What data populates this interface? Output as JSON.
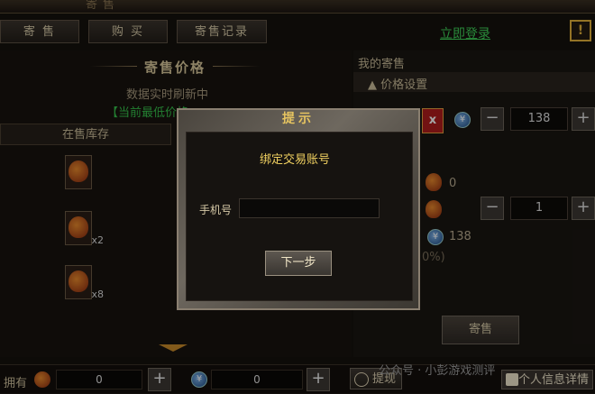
{
  "header": {
    "title": "寄售"
  },
  "tabs": [
    {
      "label": "寄 售"
    },
    {
      "label": "购 买"
    },
    {
      "label": "寄售记录"
    }
  ],
  "login_link": "立即登录",
  "alert_icon": "!",
  "left": {
    "section_title": "寄售价格",
    "refresh_text": "数据实时刷新中",
    "lowest_price_text": "【当前最低价格",
    "stock_header": "在售库存",
    "items": [
      {
        "icon": "treasure-bag-icon",
        "qty": ""
      },
      {
        "icon": "treasure-bag-icon",
        "qty": "x2"
      },
      {
        "icon": "treasure-bag-icon",
        "qty": "x8"
      }
    ]
  },
  "right": {
    "my_sale": "我的寄售",
    "price_setting": "▲ 价格设置",
    "close_label": "x",
    "price_value": "138",
    "stock_count": "0",
    "quantity_value": "1",
    "total_value": "138",
    "percent_text": "0%)",
    "sell_button": "寄售"
  },
  "bottom": {
    "own_label": "拥有",
    "bag_count": "0",
    "coin_count": "0",
    "withdraw_label": "提现",
    "info_label": "个人信息详情",
    "watermark": "公众号 · 小彭游戏测评"
  },
  "modal": {
    "title": "提示",
    "heading": "绑定交易账号",
    "phone_label": "手机号",
    "phone_value": "",
    "phone_placeholder": "",
    "next_button": "下一步"
  },
  "colors": {
    "accent_green": "#36c24c",
    "gold": "#e6c460",
    "danger": "#b01c1c"
  }
}
